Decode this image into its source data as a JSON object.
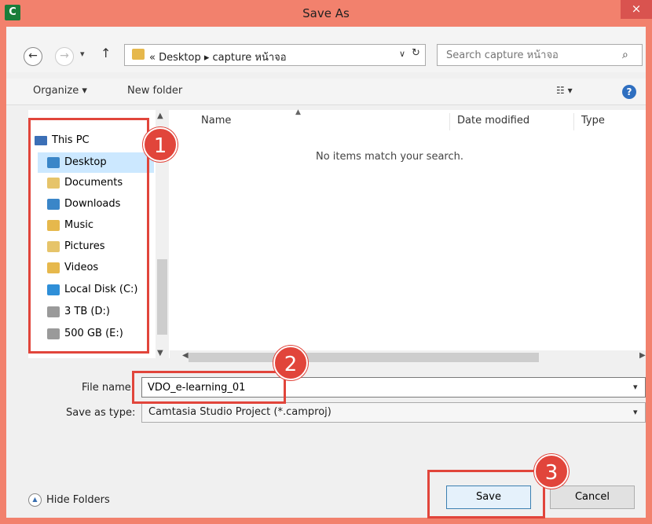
{
  "window": {
    "title": "Save As",
    "app_icon": "camtasia-icon",
    "close_glyph": "×"
  },
  "navbar": {
    "back_glyph": "←",
    "forward_glyph": "→",
    "recent_glyph": "▾",
    "up_glyph": "↑",
    "breadcrumb": "« Desktop ▸ capture หน้าจอ",
    "address_chevron": "∨",
    "refresh_glyph": "↻",
    "search_placeholder": "Search capture หน้าจอ",
    "search_glyph": "⌕"
  },
  "toolbar": {
    "organize": "Organize ▾",
    "new_folder": "New folder",
    "view": "☷ ▾",
    "help": "?"
  },
  "sidebar": {
    "this_pc": "This PC",
    "items": [
      {
        "label": "Desktop",
        "icon": "desktop-folder-icon",
        "color": "#3a86c8"
      },
      {
        "label": "Documents",
        "icon": "documents-folder-icon",
        "color": "#e6c46a"
      },
      {
        "label": "Downloads",
        "icon": "downloads-folder-icon",
        "color": "#3a86c8"
      },
      {
        "label": "Music",
        "icon": "music-folder-icon",
        "color": "#e6b84c"
      },
      {
        "label": "Pictures",
        "icon": "pictures-folder-icon",
        "color": "#e6c46a"
      },
      {
        "label": "Videos",
        "icon": "videos-folder-icon",
        "color": "#e6b84c"
      },
      {
        "label": "Local Disk (C:)",
        "icon": "windows-drive-icon",
        "color": "#2f8fd8"
      },
      {
        "label": "3 TB (D:)",
        "icon": "drive-icon",
        "color": "#9a9a9a"
      },
      {
        "label": "500 GB (E:)",
        "icon": "drive-icon",
        "color": "#9a9a9a"
      }
    ]
  },
  "files": {
    "columns": [
      "Name",
      "Date modified",
      "Type"
    ],
    "empty_message": "No items match your search."
  },
  "form": {
    "file_name_label": "File name:",
    "file_name_value": "VDO_e-learning_01",
    "save_type_label": "Save as type:",
    "save_type_value": "Camtasia Studio Project (*.camproj)"
  },
  "footer": {
    "hide_folders": "Hide Folders",
    "save": "Save",
    "cancel": "Cancel"
  },
  "annotations": {
    "badge1": "1",
    "badge2": "2",
    "badge3": "3",
    "color": "#e1453b"
  }
}
